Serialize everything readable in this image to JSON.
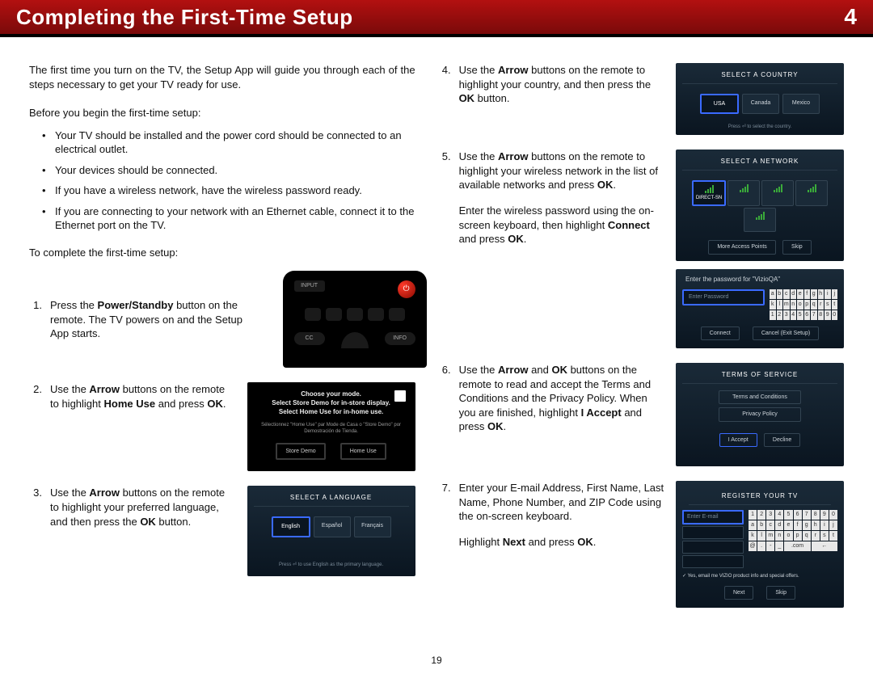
{
  "header": {
    "title": "Completing the First-Time Setup",
    "page_marker": "4"
  },
  "page_number": "19",
  "left": {
    "intro": "The first time you turn on the TV, the Setup App will guide you through each of the steps necessary to get your TV ready for use.",
    "before_heading": "Before you begin the first-time setup:",
    "bullets": [
      "Your TV should be installed and the power cord should be connected to an electrical outlet.",
      "Your devices should be connected.",
      "If you have a wireless network, have the wireless password ready.",
      "If you are connecting to your network with an Ethernet cable, connect it to the Ethernet port on the TV."
    ],
    "to_complete": "To complete the first-time setup:",
    "steps": [
      {
        "num": "1.",
        "before_bold": "Press the ",
        "bold": "Power/Standby",
        "after_bold": " button on the remote. The TV powers on and the Setup App starts."
      },
      {
        "num": "2.",
        "before_bold": "Use the ",
        "bold": "Arrow",
        "after_bold": " buttons on the remote to highlight ",
        "bold2": "Home Use",
        "after_bold2": " and press ",
        "bold3": "OK",
        "after_bold3": "."
      },
      {
        "num": "3.",
        "before_bold": "Use the ",
        "bold": "Arrow",
        "after_bold": " buttons on the remote to highlight your preferred language, and then press the ",
        "bold2": "OK",
        "after_bold2": " button."
      }
    ],
    "remote": {
      "input_label": "INPUT",
      "cc_label": "CC",
      "info_label": "INFO"
    },
    "mode_screen": {
      "line1": "Choose your mode.",
      "line2": "Select Store Demo for in-store display.",
      "line3": "Select Home Use for in-home use.",
      "sub": "Sélectionnez \"Home Use\" par Mode de Casa o \"Store Demo\" por Demostración de Tienda.",
      "btn_store": "Store Demo",
      "btn_home": "Home Use"
    },
    "lang_screen": {
      "title": "SELECT A LANGUAGE",
      "options": [
        "English",
        "Español",
        "Français"
      ],
      "foot": "Press ⏎ to use English as the primary language."
    }
  },
  "right": {
    "steps": [
      {
        "num": "4.",
        "text_parts": [
          {
            "t": "Use the "
          },
          {
            "b": "Arrow"
          },
          {
            "t": " buttons on the remote to highlight your country, and then press the "
          },
          {
            "b": "OK"
          },
          {
            "t": " button."
          }
        ],
        "screen": {
          "title": "SELECT A COUNTRY",
          "options": [
            "USA",
            "Canada",
            "Mexico"
          ],
          "foot": "Press ⏎ to select the country."
        }
      },
      {
        "num": "5.",
        "text_parts": [
          {
            "t": "Use the "
          },
          {
            "b": "Arrow"
          },
          {
            "t": " buttons on the remote to highlight your wireless network in the list of available networks and press "
          },
          {
            "b": "OK"
          },
          {
            "t": "."
          }
        ],
        "extra_parts": [
          {
            "t": "Enter the wireless password using the on-screen keyboard, then highlight "
          },
          {
            "b": "Connect"
          },
          {
            "t": " and press "
          },
          {
            "b": "OK"
          },
          {
            "t": "."
          }
        ],
        "screen": {
          "title": "SELECT A NETWORK",
          "options": [
            "DIRECT-SN",
            "",
            "",
            "",
            ""
          ],
          "btn1": "More Access Points",
          "btn2": "Skip"
        },
        "pw_screen": {
          "header": "Enter the password for \"VizioQA\"",
          "placeholder": "Enter Password",
          "btn_connect": "Connect",
          "btn_cancel": "Cancel (Exit Setup)"
        }
      },
      {
        "num": "6.",
        "text_parts": [
          {
            "t": "Use the "
          },
          {
            "b": "Arrow"
          },
          {
            "t": " and "
          },
          {
            "b": "OK"
          },
          {
            "t": " buttons on the remote to read and accept the Terms and Conditions and the Privacy Policy. When you are finished, highlight "
          },
          {
            "b": "I Accept"
          },
          {
            "t": " and press "
          },
          {
            "b": "OK"
          },
          {
            "t": "."
          }
        ],
        "screen": {
          "title": "TERMS OF SERVICE",
          "btn_terms": "Terms and Conditions",
          "btn_privacy": "Privacy Policy",
          "btn_accept": "I Accept",
          "btn_decline": "Decline"
        }
      },
      {
        "num": "7.",
        "text_parts": [
          {
            "t": "Enter your E-mail Address, First Name, Last Name, Phone Number, and ZIP Code using the on-screen keyboard."
          }
        ],
        "extra_parts": [
          {
            "t": "Highlight "
          },
          {
            "b": "Next"
          },
          {
            "t": " and press "
          },
          {
            "b": "OK"
          },
          {
            "t": "."
          }
        ],
        "screen": {
          "title": "REGISTER YOUR TV",
          "placeholder": "Enter E-mail",
          "checkbox": "✓ Yes, email me VIZIO product info and special offers.",
          "btn_next": "Next",
          "btn_skip": "Skip"
        }
      }
    ]
  }
}
